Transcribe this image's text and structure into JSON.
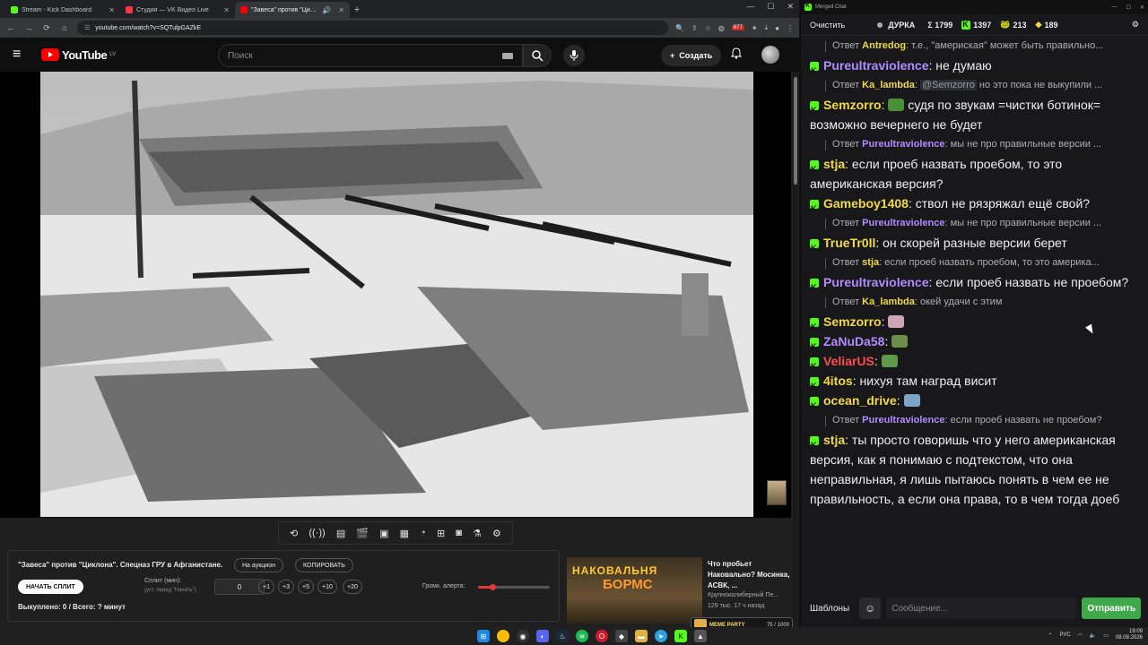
{
  "browser": {
    "tabs": [
      {
        "title": "Stream - Kick Dashboard",
        "color": "#53fc18",
        "active": false
      },
      {
        "title": "Студия — VK Видео Live",
        "color": "#ff3347",
        "active": false
      },
      {
        "title": "\"Завеса\" против \"Циклона\"",
        "color": "#ff0000",
        "active": true
      }
    ],
    "url": "youtube.com/watch?v=SQTulpGAZkE",
    "ext_badge": "677"
  },
  "youtube": {
    "logo": "YouTube",
    "region": "LV",
    "search_placeholder": "Поиск",
    "create_label": "Создать"
  },
  "toolbar": {
    "icons": [
      "loop-icon",
      "broadcast-icon",
      "subtitles-icon",
      "clapper-icon",
      "screen-icon",
      "film-icon",
      "speed-icon",
      "add-clip-icon",
      "camera-icon",
      "flask-icon",
      "settings-icon"
    ]
  },
  "panel": {
    "title": "\"Завеса\" против \"Циклона\". Спецназ ГРУ в Афганистане.",
    "auction_button": "На аукцион",
    "copy_button": "КОПИРОВАТЬ",
    "start_button": "НАЧАТЬ СПЛИТ",
    "split_label": "Сплит (мин):",
    "split_hint": "(уст. перед \"Начать\")",
    "split_value": "0",
    "increments": [
      "+1",
      "+3",
      "+5",
      "+10",
      "+20"
    ],
    "volume_label": "Громк. алерта:",
    "volume_level": 0.2,
    "bought": "Выкуплено: 0 / Всего: ? минут"
  },
  "recommendation": {
    "thumb_line1": "НАКОВАЛЬНЯ",
    "thumb_line2": "БОРМС",
    "title": "Что пробьет Наковально? Мосинка, АСВК, ...",
    "channel": "Крупнокалиберный Пе...",
    "meta": "129 тыс. 17 ч назад"
  },
  "overlay": {
    "label": "MEME PARTY",
    "count": "75 / 1000"
  },
  "chat": {
    "window_title": "Merged Chat",
    "clear": "Очистить",
    "stream_name": "ДУРКА",
    "sum_label": "Σ 1799",
    "kick_count": "1397",
    "frog_count": "213",
    "third_count": "189",
    "messages": [
      {
        "type": "reply",
        "prefix": "Ответ",
        "user": "Antredog",
        "color": "#f0d94a",
        "text": ": т.е., \"америская\" может быть правильно..."
      },
      {
        "type": "msg",
        "user": "Pureultraviolence",
        "color": "#b18cff",
        "text": ": не думаю"
      },
      {
        "type": "reply",
        "prefix": "Ответ",
        "user": "Ka_lambda",
        "color": "#f0d94a",
        "mention": "@Semzorro",
        "text": " но это пока не выкупили ..."
      },
      {
        "type": "msg",
        "user": "Semzorro",
        "color": "#f0d94a",
        "emote": "#4a8f3a",
        "text": " судя по звукам =чистки ботинок= возможно вечернего не будет"
      },
      {
        "type": "reply",
        "prefix": "Ответ",
        "user": "Pureultraviolence",
        "color": "#b18cff",
        "text": ": мы не про правильные версии ..."
      },
      {
        "type": "msg",
        "user": "stja",
        "color": "#f0d94a",
        "text": ": если проеб назвать проебом, то это американская версия?"
      },
      {
        "type": "msg",
        "user": "Gameboy1408",
        "color": "#f0d94a",
        "text": ": ствол не рязряжал ещё свой?"
      },
      {
        "type": "reply",
        "prefix": "Ответ",
        "user": "Pureultraviolence",
        "color": "#b18cff",
        "text": ": мы не про правильные версии ..."
      },
      {
        "type": "msg",
        "user": "TrueTr0ll",
        "color": "#f0d94a",
        "text": ": он скорей разные версии берет"
      },
      {
        "type": "reply",
        "prefix": "Ответ",
        "user": "stja",
        "color": "#f0d94a",
        "text": ": если проеб назвать проебом, то это америка..."
      },
      {
        "type": "msg",
        "user": "Pureultraviolence",
        "color": "#b18cff",
        "text": ": если проеб назвать не проебом?"
      },
      {
        "type": "reply",
        "prefix": "Ответ",
        "user": "Ka_lambda",
        "color": "#f0d94a",
        "text": ": окей  удачи с этим"
      },
      {
        "type": "msg",
        "user": "Semzorro",
        "color": "#f0d94a",
        "emote": "#cfa3b8",
        "text": ""
      },
      {
        "type": "msg",
        "user": "ZaNuDa58",
        "color": "#b18cff",
        "emote": "#6b8f4a",
        "text": ""
      },
      {
        "type": "msg",
        "user": "VeliarUS",
        "color": "#ff4d4d",
        "emote": "#5e9a4a",
        "text": ""
      },
      {
        "type": "msg",
        "user": "4itos",
        "color": "#f0d94a",
        "text": ": нихуя там наград висит"
      },
      {
        "type": "msg",
        "user": "ocean_drive",
        "color": "#f0d94a",
        "emote": "#7fa4c9",
        "text": ""
      },
      {
        "type": "reply",
        "prefix": "Ответ",
        "user": "Pureultraviolence",
        "color": "#b18cff",
        "text": ": если проеб назвать не проебом?"
      },
      {
        "type": "msg",
        "user": "stja",
        "color": "#f0d94a",
        "text": ": ты просто говоришь что у него американская версия, как я понимаю с подтекстом, что она неправильная, я лишь пытаюсь понять в чем ее не правильность, а если она права, то в чем тогда доеб"
      }
    ],
    "templates_label": "Шаблоны",
    "input_placeholder": "Сообщение...",
    "send_label": "Отправить"
  },
  "taskbar": {
    "lang": "РУС",
    "time": "19:09",
    "date": "08.08.2026"
  }
}
